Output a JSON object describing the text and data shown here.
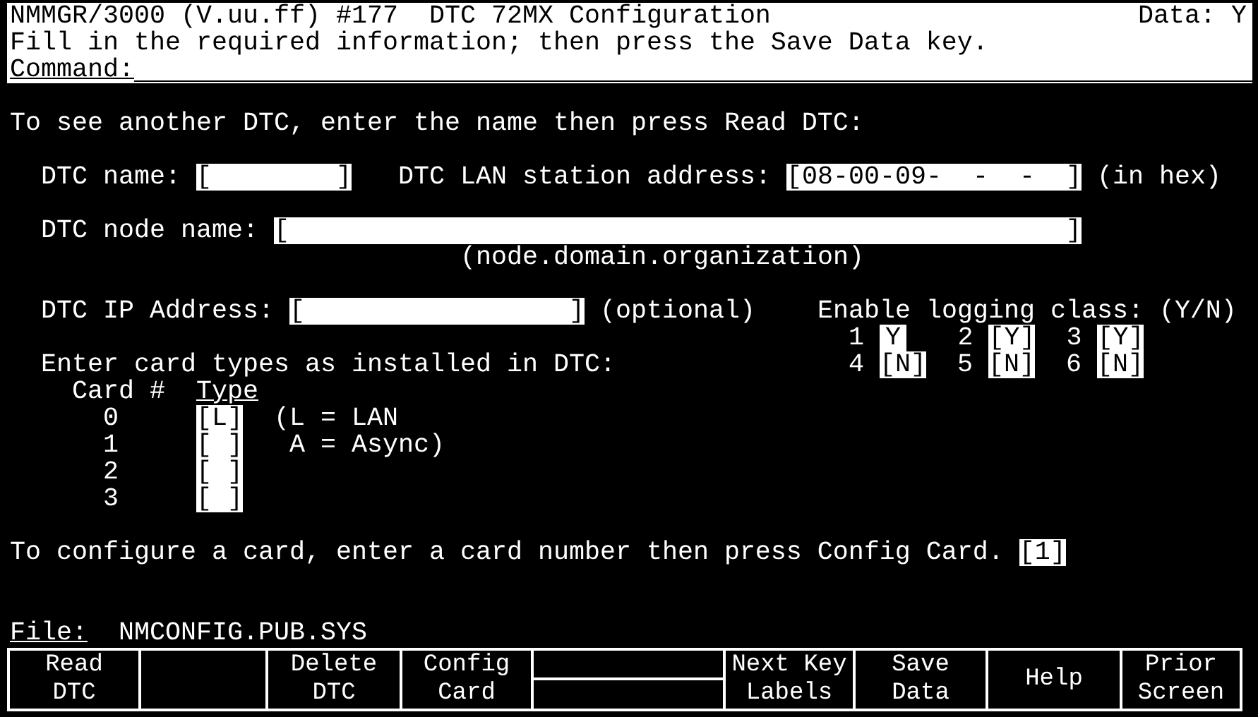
{
  "header": {
    "title": "NMMGR/3000 (V.uu.ff) #177  DTC 72MX Configuration",
    "data_status": "Data: Y",
    "message": "Fill in the required information; then press the Save Data key.",
    "command_label": "Command:"
  },
  "read_prompt": "To see another DTC, enter the name then press Read DTC:",
  "dtc_name": {
    "label": "DTC name:",
    "field": "[        ]"
  },
  "lan_address": {
    "label": "DTC LAN station address:",
    "field": "[08-00-09-  -  -  ]",
    "note": "(in hex)"
  },
  "node_name": {
    "label": "DTC node name:",
    "field": "[                                                  ]",
    "hint": "(node.domain.organization)"
  },
  "ip_address": {
    "label": "DTC IP Address:",
    "field": "[                 ]",
    "note": "(optional)"
  },
  "logging": {
    "label": "Enable logging class: (Y/N)",
    "classes": [
      {
        "number": "1",
        "field": "Y"
      },
      {
        "number": "2",
        "field": "[Y]"
      },
      {
        "number": "3",
        "field": "[Y]"
      },
      {
        "number": "4",
        "field": "[N]"
      },
      {
        "number": "5",
        "field": "[N]"
      },
      {
        "number": "6",
        "field": "[N]"
      }
    ]
  },
  "cards": {
    "prompt": "Enter card types as installed in DTC:",
    "column_1": "Card #",
    "column_2": "Type",
    "legend": [
      "(L = LAN",
      "A = Async)"
    ],
    "rows": [
      {
        "number": "0",
        "field": "[L]"
      },
      {
        "number": "1",
        "field": "[ ]"
      },
      {
        "number": "2",
        "field": "[ ]"
      },
      {
        "number": "3",
        "field": "[ ]"
      }
    ]
  },
  "config_prompt": "To configure a card, enter a card number then press Config Card.",
  "config_field": "[1]",
  "file": {
    "label": "File:",
    "name": "NMCONFIG.PUB.SYS"
  },
  "softkeys": [
    {
      "kind": "label",
      "lines": [
        "Read",
        "DTC"
      ]
    },
    {
      "kind": "blank"
    },
    {
      "kind": "label",
      "lines": [
        "Delete",
        "DTC"
      ]
    },
    {
      "kind": "label",
      "lines": [
        "Config",
        "Card"
      ]
    },
    {
      "kind": "split"
    },
    {
      "kind": "label",
      "lines": [
        "Next Key",
        "Labels"
      ]
    },
    {
      "kind": "label",
      "lines": [
        "Save",
        "Data"
      ]
    },
    {
      "kind": "label",
      "lines": [
        "Help"
      ]
    },
    {
      "kind": "label",
      "lines": [
        "Prior",
        "Screen"
      ]
    }
  ]
}
